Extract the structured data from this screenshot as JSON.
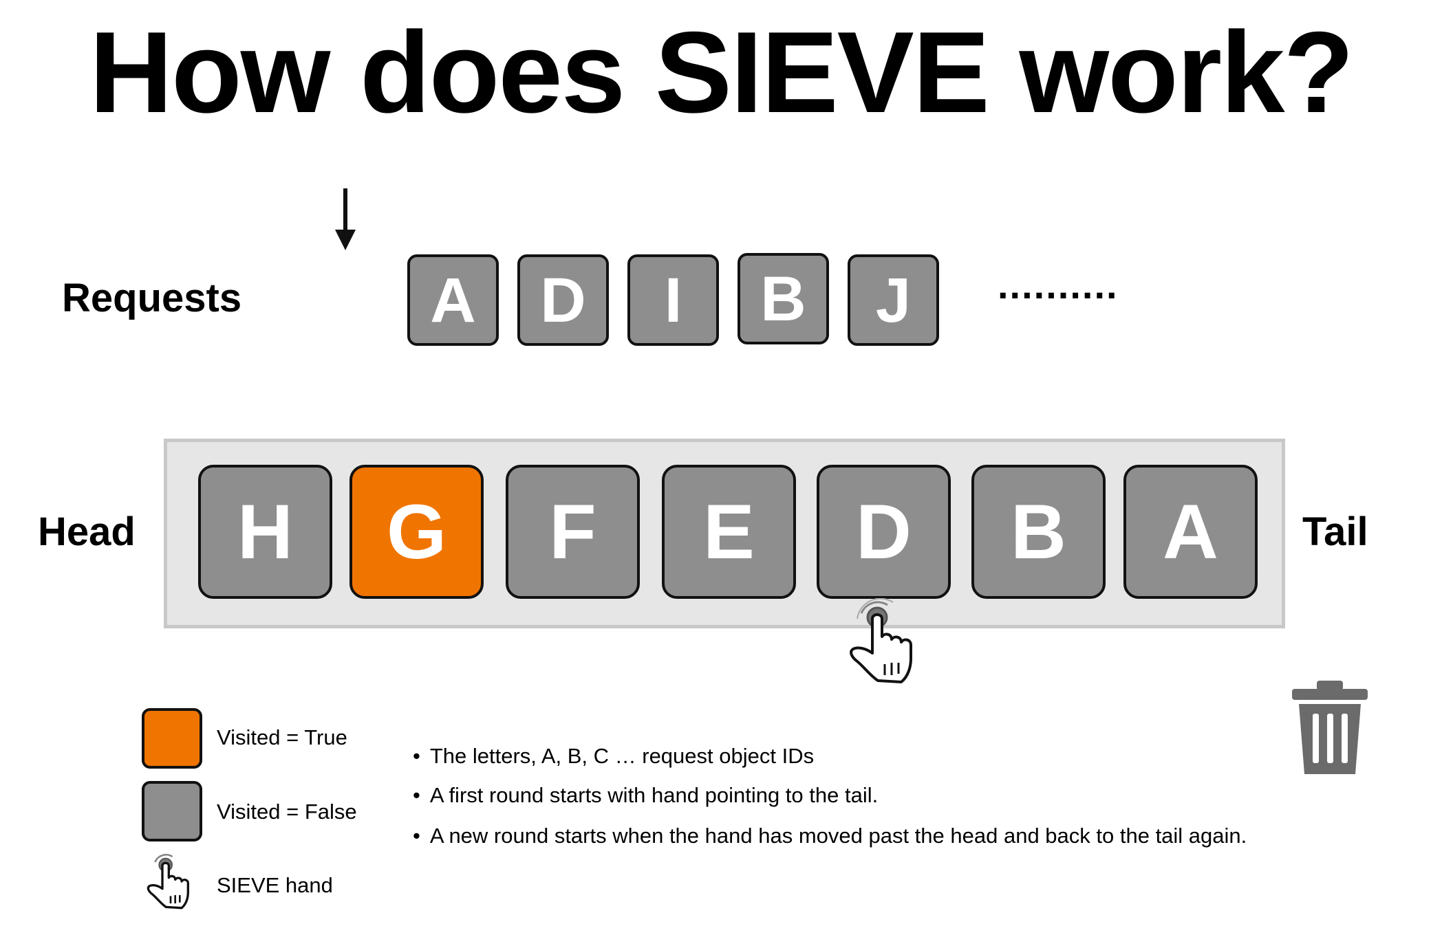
{
  "title": "How does SIEVE work?",
  "requests": {
    "label": "Requests",
    "items": [
      "A",
      "D",
      "I",
      "B",
      "J"
    ],
    "ellipsis": ".........."
  },
  "cache": {
    "head_label": "Head",
    "tail_label": "Tail",
    "items": [
      {
        "letter": "H",
        "visited": false
      },
      {
        "letter": "G",
        "visited": true
      },
      {
        "letter": "F",
        "visited": false
      },
      {
        "letter": "E",
        "visited": false
      },
      {
        "letter": "D",
        "visited": false
      },
      {
        "letter": "B",
        "visited": false
      },
      {
        "letter": "A",
        "visited": false
      }
    ],
    "hand_points_to": "D"
  },
  "legend": {
    "visited_true": "Visited = True",
    "visited_false": "Visited = False",
    "hand": "SIEVE hand"
  },
  "notes": [
    "The letters, A, B, C … request object IDs",
    "A first round starts with hand pointing to the tail.",
    "A new round starts when the hand has moved past the head and back to the tail again."
  ],
  "colors": {
    "visited_true": "#f07400",
    "visited_false": "#8e8e8e"
  },
  "icons": {
    "request_arrow": "down-arrow-icon",
    "hand": "pointing-hand-icon",
    "eviction": "trash-icon"
  }
}
